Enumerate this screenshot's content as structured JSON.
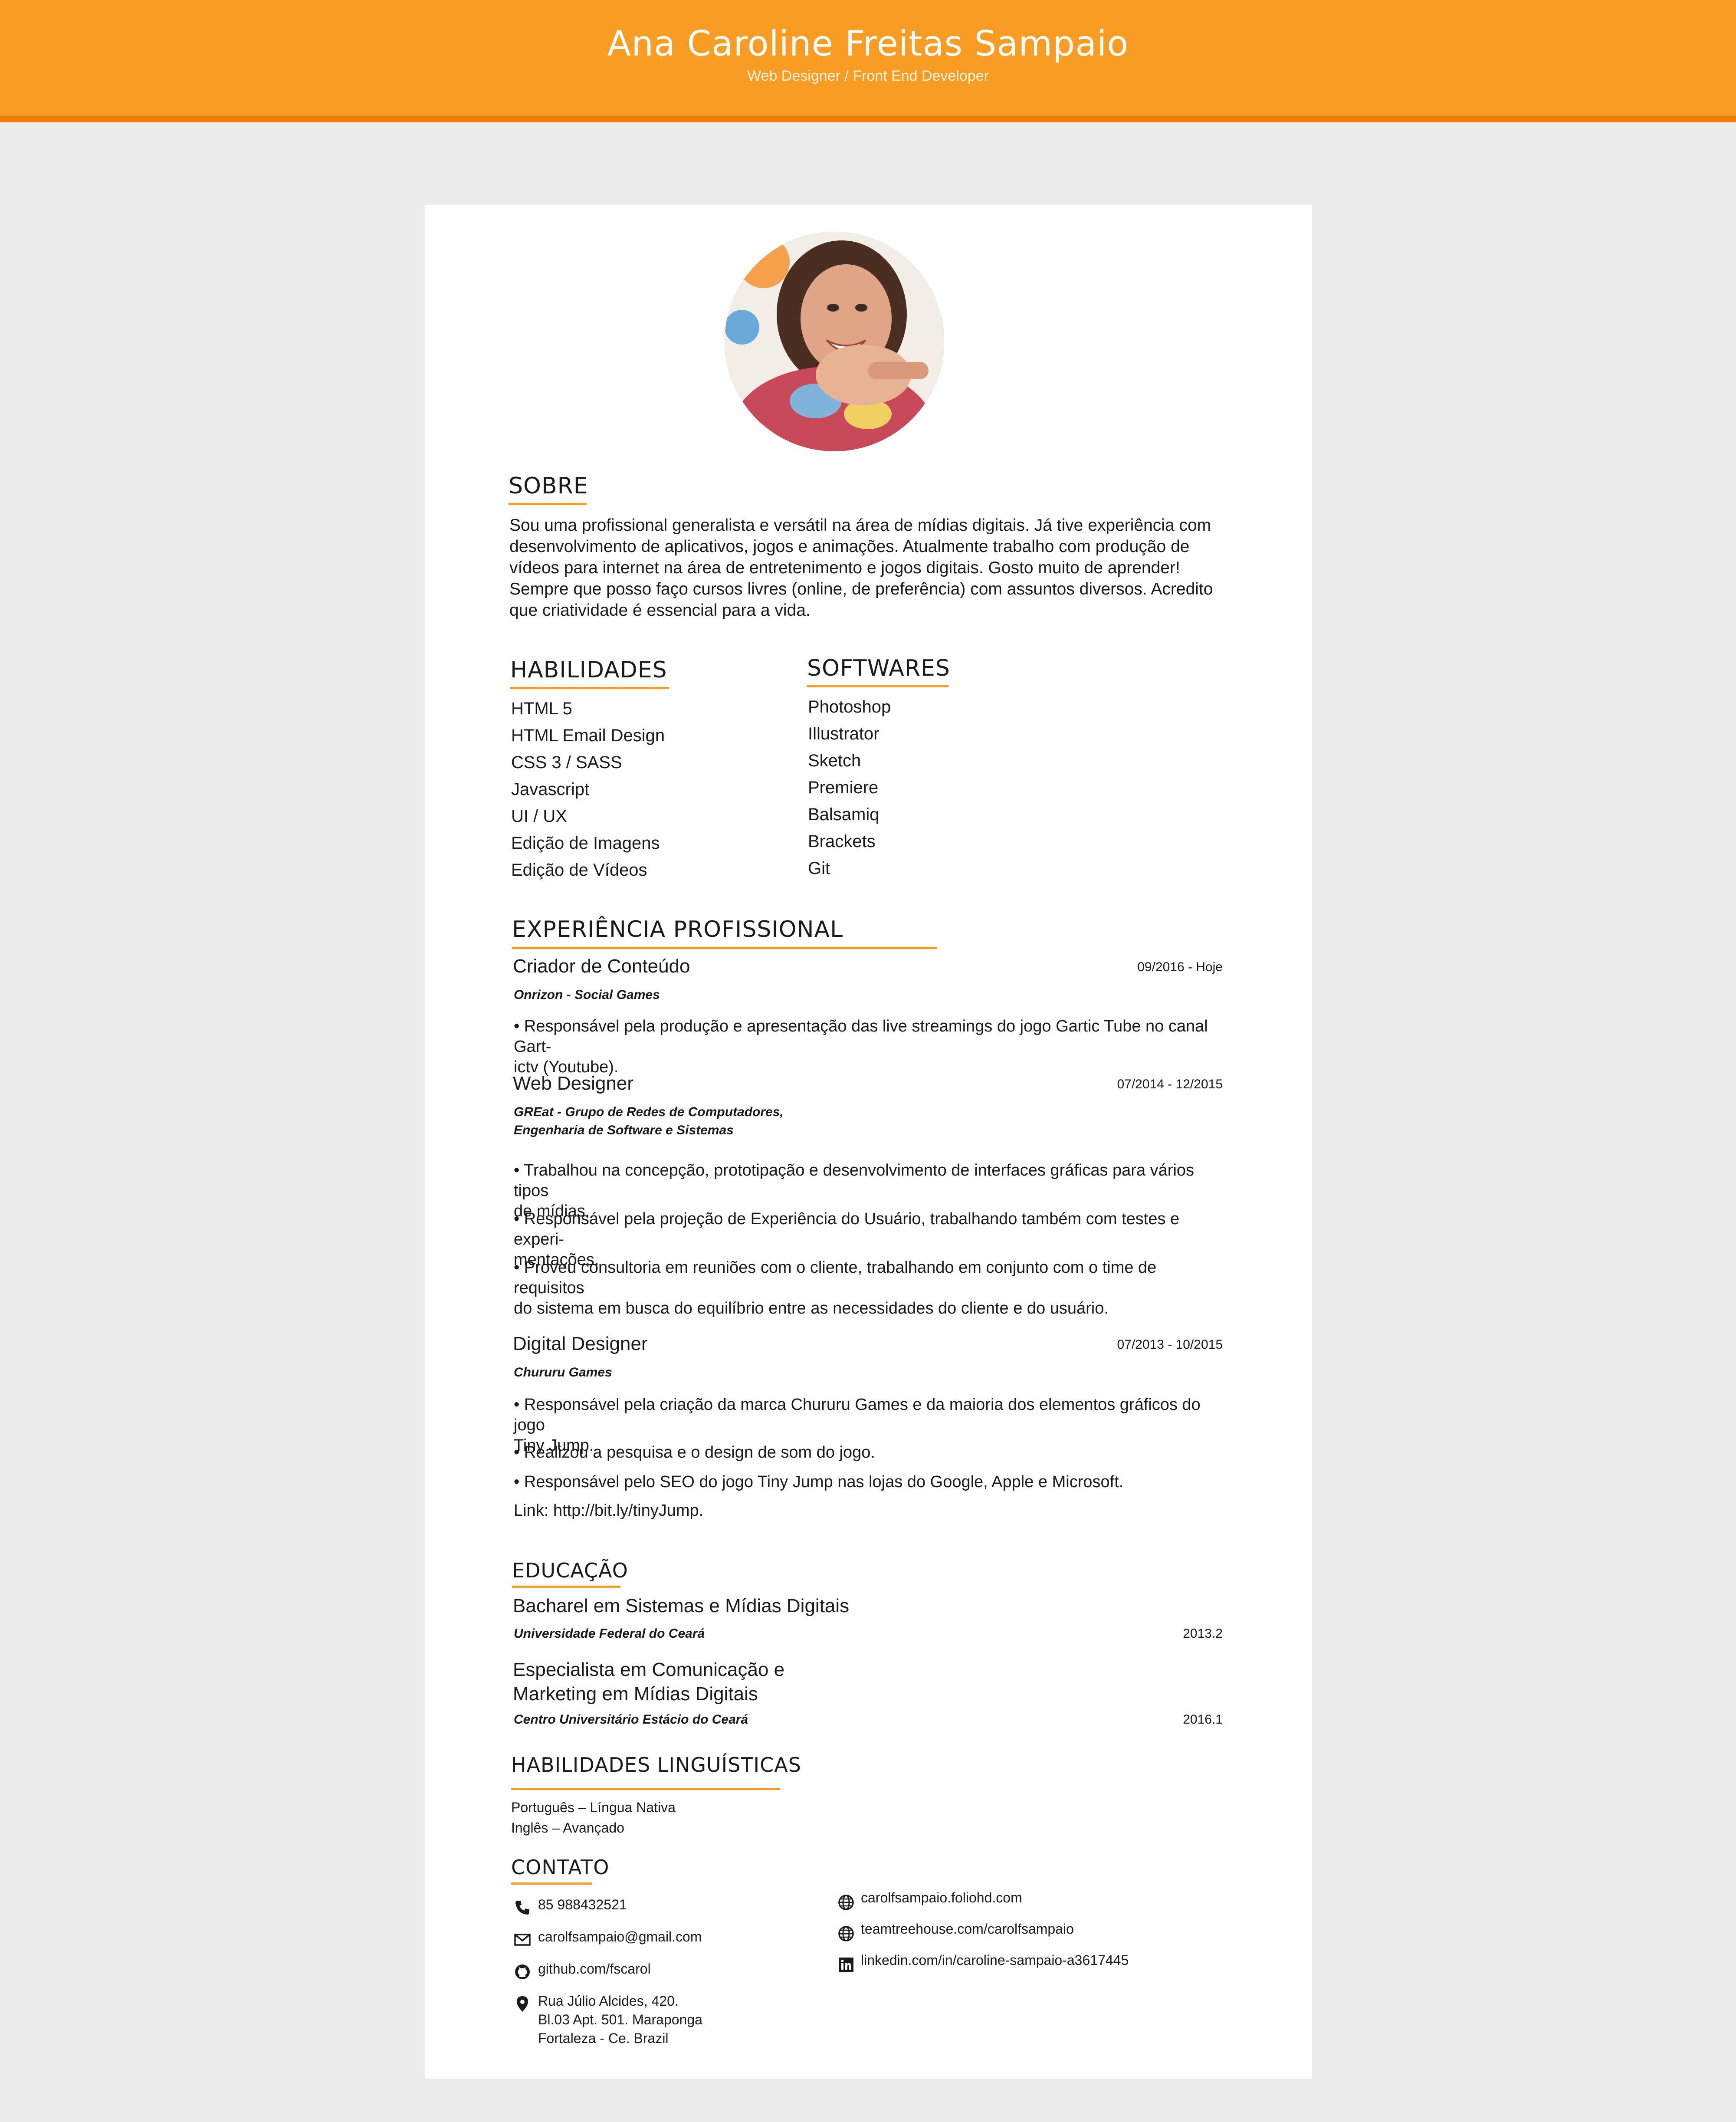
{
  "header": {
    "name": "Ana Caroline Freitas Sampaio",
    "subtitle": "Web Designer / Front End Developer"
  },
  "colors": {
    "accent": "#f89c24",
    "accent_dark": "#f07f00",
    "page_bg": "#ececec"
  },
  "about": {
    "title": "SOBRE",
    "lines": [
      "Sou uma profissional generalista e versátil na área de mídias digitais. Já tive experiência com",
      "desenvolvimento de aplicativos, jogos e animações. Atualmente trabalho com produção de",
      "vídeos para internet na área de entretenimento e jogos digitais. Gosto muito de aprender!",
      "Sempre que posso faço cursos livres (online, de preferência) com assuntos diversos. Acredito",
      "que criatividade é essencial para a vida."
    ]
  },
  "skills": {
    "title": "HABILIDADES",
    "items": [
      "HTML 5",
      "HTML Email Design",
      "CSS 3 / SASS",
      "Javascript",
      "UI / UX",
      "Edição de Imagens",
      "Edição de Vídeos"
    ]
  },
  "software": {
    "title": "SOFTWARES",
    "items": [
      "Photoshop",
      "Illustrator",
      "Sketch",
      "Premiere",
      "Balsamiq",
      "Brackets",
      "Git"
    ]
  },
  "experience": {
    "title": "EXPERIÊNCIA PROFISSIONAL",
    "jobs": [
      {
        "title": "Criador de Conteúdo",
        "date": "09/2016 - Hoje",
        "company": [
          "Onrizon - Social Games"
        ],
        "bullets": [
          [
            "• Responsável pela produção e apresentação das live streamings do jogo Gartic Tube no canal Gart-",
            "ictv (Youtube)."
          ]
        ]
      },
      {
        "title": "Web Designer",
        "date": "07/2014 - 12/2015",
        "company": [
          "GREat - Grupo de Redes de Computadores,",
          "Engenharia de Software e Sistemas"
        ],
        "bullets": [
          [
            "• Trabalhou na concepção, prototipação e desenvolvimento de interfaces gráficas para vários tipos",
            "de mídias."
          ],
          [
            "• Responsável pela projeção de Experiência do Usuário, trabalhando também com testes e experi-",
            "mentações."
          ],
          [
            "• Proveu consultoria em reuniões com o cliente, trabalhando  em conjunto com o time de requisitos",
            "do sistema em busca do equilíbrio entre as necessidades do cliente e do usuário."
          ]
        ]
      },
      {
        "title": "Digital Designer",
        "date": "07/2013 - 10/2015",
        "company": [
          "Chururu Games"
        ],
        "bullets": [
          [
            "• Responsável pela criação da marca Chururu Games e da maioria dos elementos gráficos do jogo",
            "Tiny Jump."
          ],
          [
            "• Realizou a pesquisa e o design de som do jogo."
          ],
          [
            "• Responsável pelo SEO do jogo Tiny Jump nas lojas do Google, Apple e Microsoft."
          ],
          [
            "Link: http://bit.ly/tinyJump."
          ]
        ]
      }
    ]
  },
  "education": {
    "title": "EDUCAÇÃO",
    "items": [
      {
        "degree": [
          "Bacharel em Sistemas e Mídias Digitais"
        ],
        "school": "Universidade Federal do Ceará",
        "date": "2013.2"
      },
      {
        "degree": [
          "Especialista em Comunicação e",
          "Marketing em Mídias Digitais"
        ],
        "school": "Centro Universitário Estácio do Ceará",
        "date": "2016.1"
      }
    ]
  },
  "languages": {
    "title": "HABILIDADES LINGUÍSTICAS",
    "items": [
      "Português – Língua Nativa",
      "Inglês – Avançado"
    ]
  },
  "contact": {
    "title": "CONTATO",
    "left": [
      {
        "icon": "phone-icon",
        "lines": [
          "85 988432521"
        ]
      },
      {
        "icon": "mail-icon",
        "lines": [
          "carolfsampaio@gmail.com"
        ]
      },
      {
        "icon": "github-icon",
        "lines": [
          "github.com/fscarol"
        ]
      },
      {
        "icon": "map-pin-icon",
        "lines": [
          "Rua Júlio Alcides, 420.",
          "Bl.03 Apt. 501. Maraponga",
          "Fortaleza - Ce. Brazil"
        ]
      }
    ],
    "right": [
      {
        "icon": "globe-icon",
        "lines": [
          "carolfsampaio.foliohd.com"
        ]
      },
      {
        "icon": "globe-icon",
        "lines": [
          "teamtreehouse.com/carolfsampaio"
        ]
      },
      {
        "icon": "linkedin-icon",
        "lines": [
          "linkedin.com/in/caroline-sampaio-a3617445"
        ]
      }
    ]
  }
}
